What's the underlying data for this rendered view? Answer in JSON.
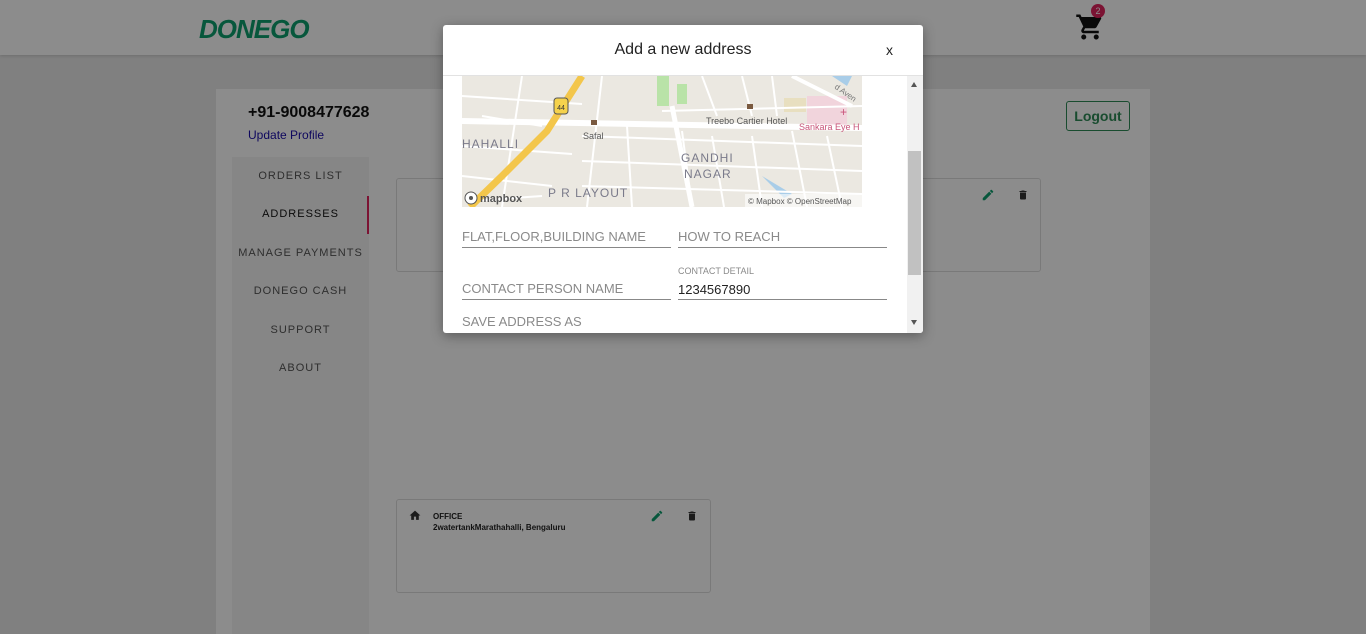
{
  "header": {
    "logo_text": "DONEGO",
    "cart_count": "2"
  },
  "profile": {
    "phone": "+91-9008477628",
    "update_link": "Update Profile",
    "logout_label": "Logout"
  },
  "sidebar": {
    "items": [
      {
        "label": "ORDERS LIST"
      },
      {
        "label": "ADDRESSES"
      },
      {
        "label": "MANAGE PAYMENTS"
      },
      {
        "label": "DONEGO CASH"
      },
      {
        "label": "SUPPORT"
      },
      {
        "label": "ABOUT"
      }
    ],
    "active_index": 1
  },
  "addresses": [
    {
      "type": "OFFICE",
      "line": "2watertankMarathahalli, Bengaluru"
    }
  ],
  "modal": {
    "title": "Add a new address",
    "close_label": "x",
    "map": {
      "labels": {
        "area1": "HAHALLI",
        "area2": "P R LAYOUT",
        "area3a": "GANDHI",
        "area3b": "NAGAR",
        "poi1": "Safal",
        "poi2": "Treebo Cartier Hotel",
        "poi3": "Sankara Eye H",
        "road_badge": "44",
        "corner_road": "d Aven",
        "brand": "mapbox",
        "attribution": "© Mapbox © OpenStreetMap"
      }
    },
    "fields": {
      "flat_placeholder": "FLAT,FLOOR,BUILDING NAME",
      "reach_placeholder": "HOW TO REACH",
      "contact_name_placeholder": "CONTACT PERSON NAME",
      "contact_detail_label": "CONTACT DETAIL",
      "contact_detail_value": "1234567890",
      "save_as_label": "SAVE ADDRESS AS"
    }
  },
  "colors": {
    "brand_green": "#0d9e6e",
    "accent_pink": "#e0245e",
    "logout_green": "#2e8b57"
  }
}
